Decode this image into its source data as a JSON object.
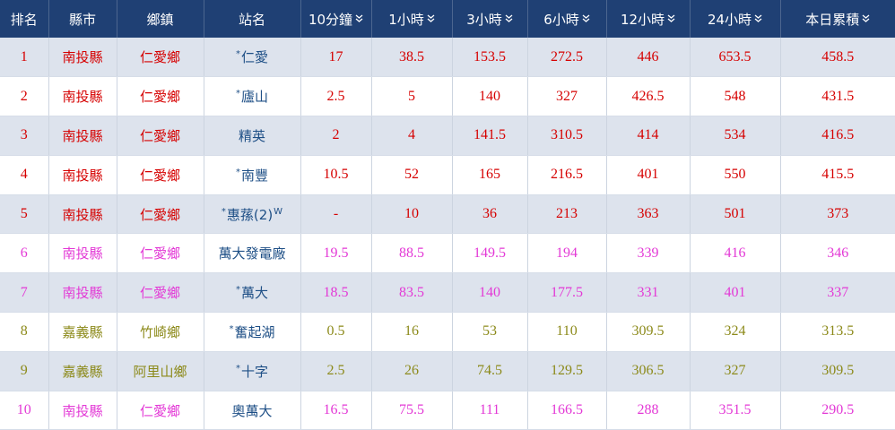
{
  "table": {
    "headers": [
      {
        "label": "排名",
        "sortable": false
      },
      {
        "label": "縣市",
        "sortable": false
      },
      {
        "label": "鄉鎮",
        "sortable": false
      },
      {
        "label": "站名",
        "sortable": false
      },
      {
        "label": "10分鐘",
        "sortable": true
      },
      {
        "label": "1小時",
        "sortable": true
      },
      {
        "label": "3小時",
        "sortable": true
      },
      {
        "label": "6小時",
        "sortable": true
      },
      {
        "label": "12小時",
        "sortable": true
      },
      {
        "label": "24小時",
        "sortable": true
      },
      {
        "label": "本日累積",
        "sortable": true
      }
    ],
    "sort_icon": "double-chevron-down-icon",
    "rows": [
      {
        "rank": "1",
        "county": "南投縣",
        "township": "仁愛鄉",
        "station": "仁愛",
        "star": "*",
        "sup": "",
        "v10m": "17",
        "v1h": "38.5",
        "v3h": "153.5",
        "v6h": "272.5",
        "v12h": "446",
        "v24h": "653.5",
        "today": "458.5",
        "color": "#d60000"
      },
      {
        "rank": "2",
        "county": "南投縣",
        "township": "仁愛鄉",
        "station": "廬山",
        "star": "*",
        "sup": "",
        "v10m": "2.5",
        "v1h": "5",
        "v3h": "140",
        "v6h": "327",
        "v12h": "426.5",
        "v24h": "548",
        "today": "431.5",
        "color": "#d60000"
      },
      {
        "rank": "3",
        "county": "南投縣",
        "township": "仁愛鄉",
        "station": "精英",
        "star": "",
        "sup": "",
        "v10m": "2",
        "v1h": "4",
        "v3h": "141.5",
        "v6h": "310.5",
        "v12h": "414",
        "v24h": "534",
        "today": "416.5",
        "color": "#d60000"
      },
      {
        "rank": "4",
        "county": "南投縣",
        "township": "仁愛鄉",
        "station": "南豐",
        "star": "*",
        "sup": "",
        "v10m": "10.5",
        "v1h": "52",
        "v3h": "165",
        "v6h": "216.5",
        "v12h": "401",
        "v24h": "550",
        "today": "415.5",
        "color": "#d60000"
      },
      {
        "rank": "5",
        "county": "南投縣",
        "township": "仁愛鄉",
        "station": "惠蓀(2)",
        "star": "*",
        "sup": "W",
        "v10m": "-",
        "v1h": "10",
        "v3h": "36",
        "v6h": "213",
        "v12h": "363",
        "v24h": "501",
        "today": "373",
        "color": "#d60000"
      },
      {
        "rank": "6",
        "county": "南投縣",
        "township": "仁愛鄉",
        "station": "萬大發電廠",
        "star": "",
        "sup": "",
        "v10m": "19.5",
        "v1h": "88.5",
        "v3h": "149.5",
        "v6h": "194",
        "v12h": "339",
        "v24h": "416",
        "today": "346",
        "color": "#e339d6"
      },
      {
        "rank": "7",
        "county": "南投縣",
        "township": "仁愛鄉",
        "station": "萬大",
        "star": "*",
        "sup": "",
        "v10m": "18.5",
        "v1h": "83.5",
        "v3h": "140",
        "v6h": "177.5",
        "v12h": "331",
        "v24h": "401",
        "today": "337",
        "color": "#e339d6"
      },
      {
        "rank": "8",
        "county": "嘉義縣",
        "township": "竹崎鄉",
        "station": "奮起湖",
        "star": "*",
        "sup": "",
        "v10m": "0.5",
        "v1h": "16",
        "v3h": "53",
        "v6h": "110",
        "v12h": "309.5",
        "v24h": "324",
        "today": "313.5",
        "color": "#8c8a1a"
      },
      {
        "rank": "9",
        "county": "嘉義縣",
        "township": "阿里山鄉",
        "station": "十字",
        "star": "*",
        "sup": "",
        "v10m": "2.5",
        "v1h": "26",
        "v3h": "74.5",
        "v6h": "129.5",
        "v12h": "306.5",
        "v24h": "327",
        "today": "309.5",
        "color": "#8c8a1a"
      },
      {
        "rank": "10",
        "county": "南投縣",
        "township": "仁愛鄉",
        "station": "奧萬大",
        "star": "",
        "sup": "",
        "v10m": "16.5",
        "v1h": "75.5",
        "v3h": "111",
        "v6h": "166.5",
        "v12h": "288",
        "v24h": "351.5",
        "today": "290.5",
        "color": "#e339d6"
      }
    ]
  }
}
